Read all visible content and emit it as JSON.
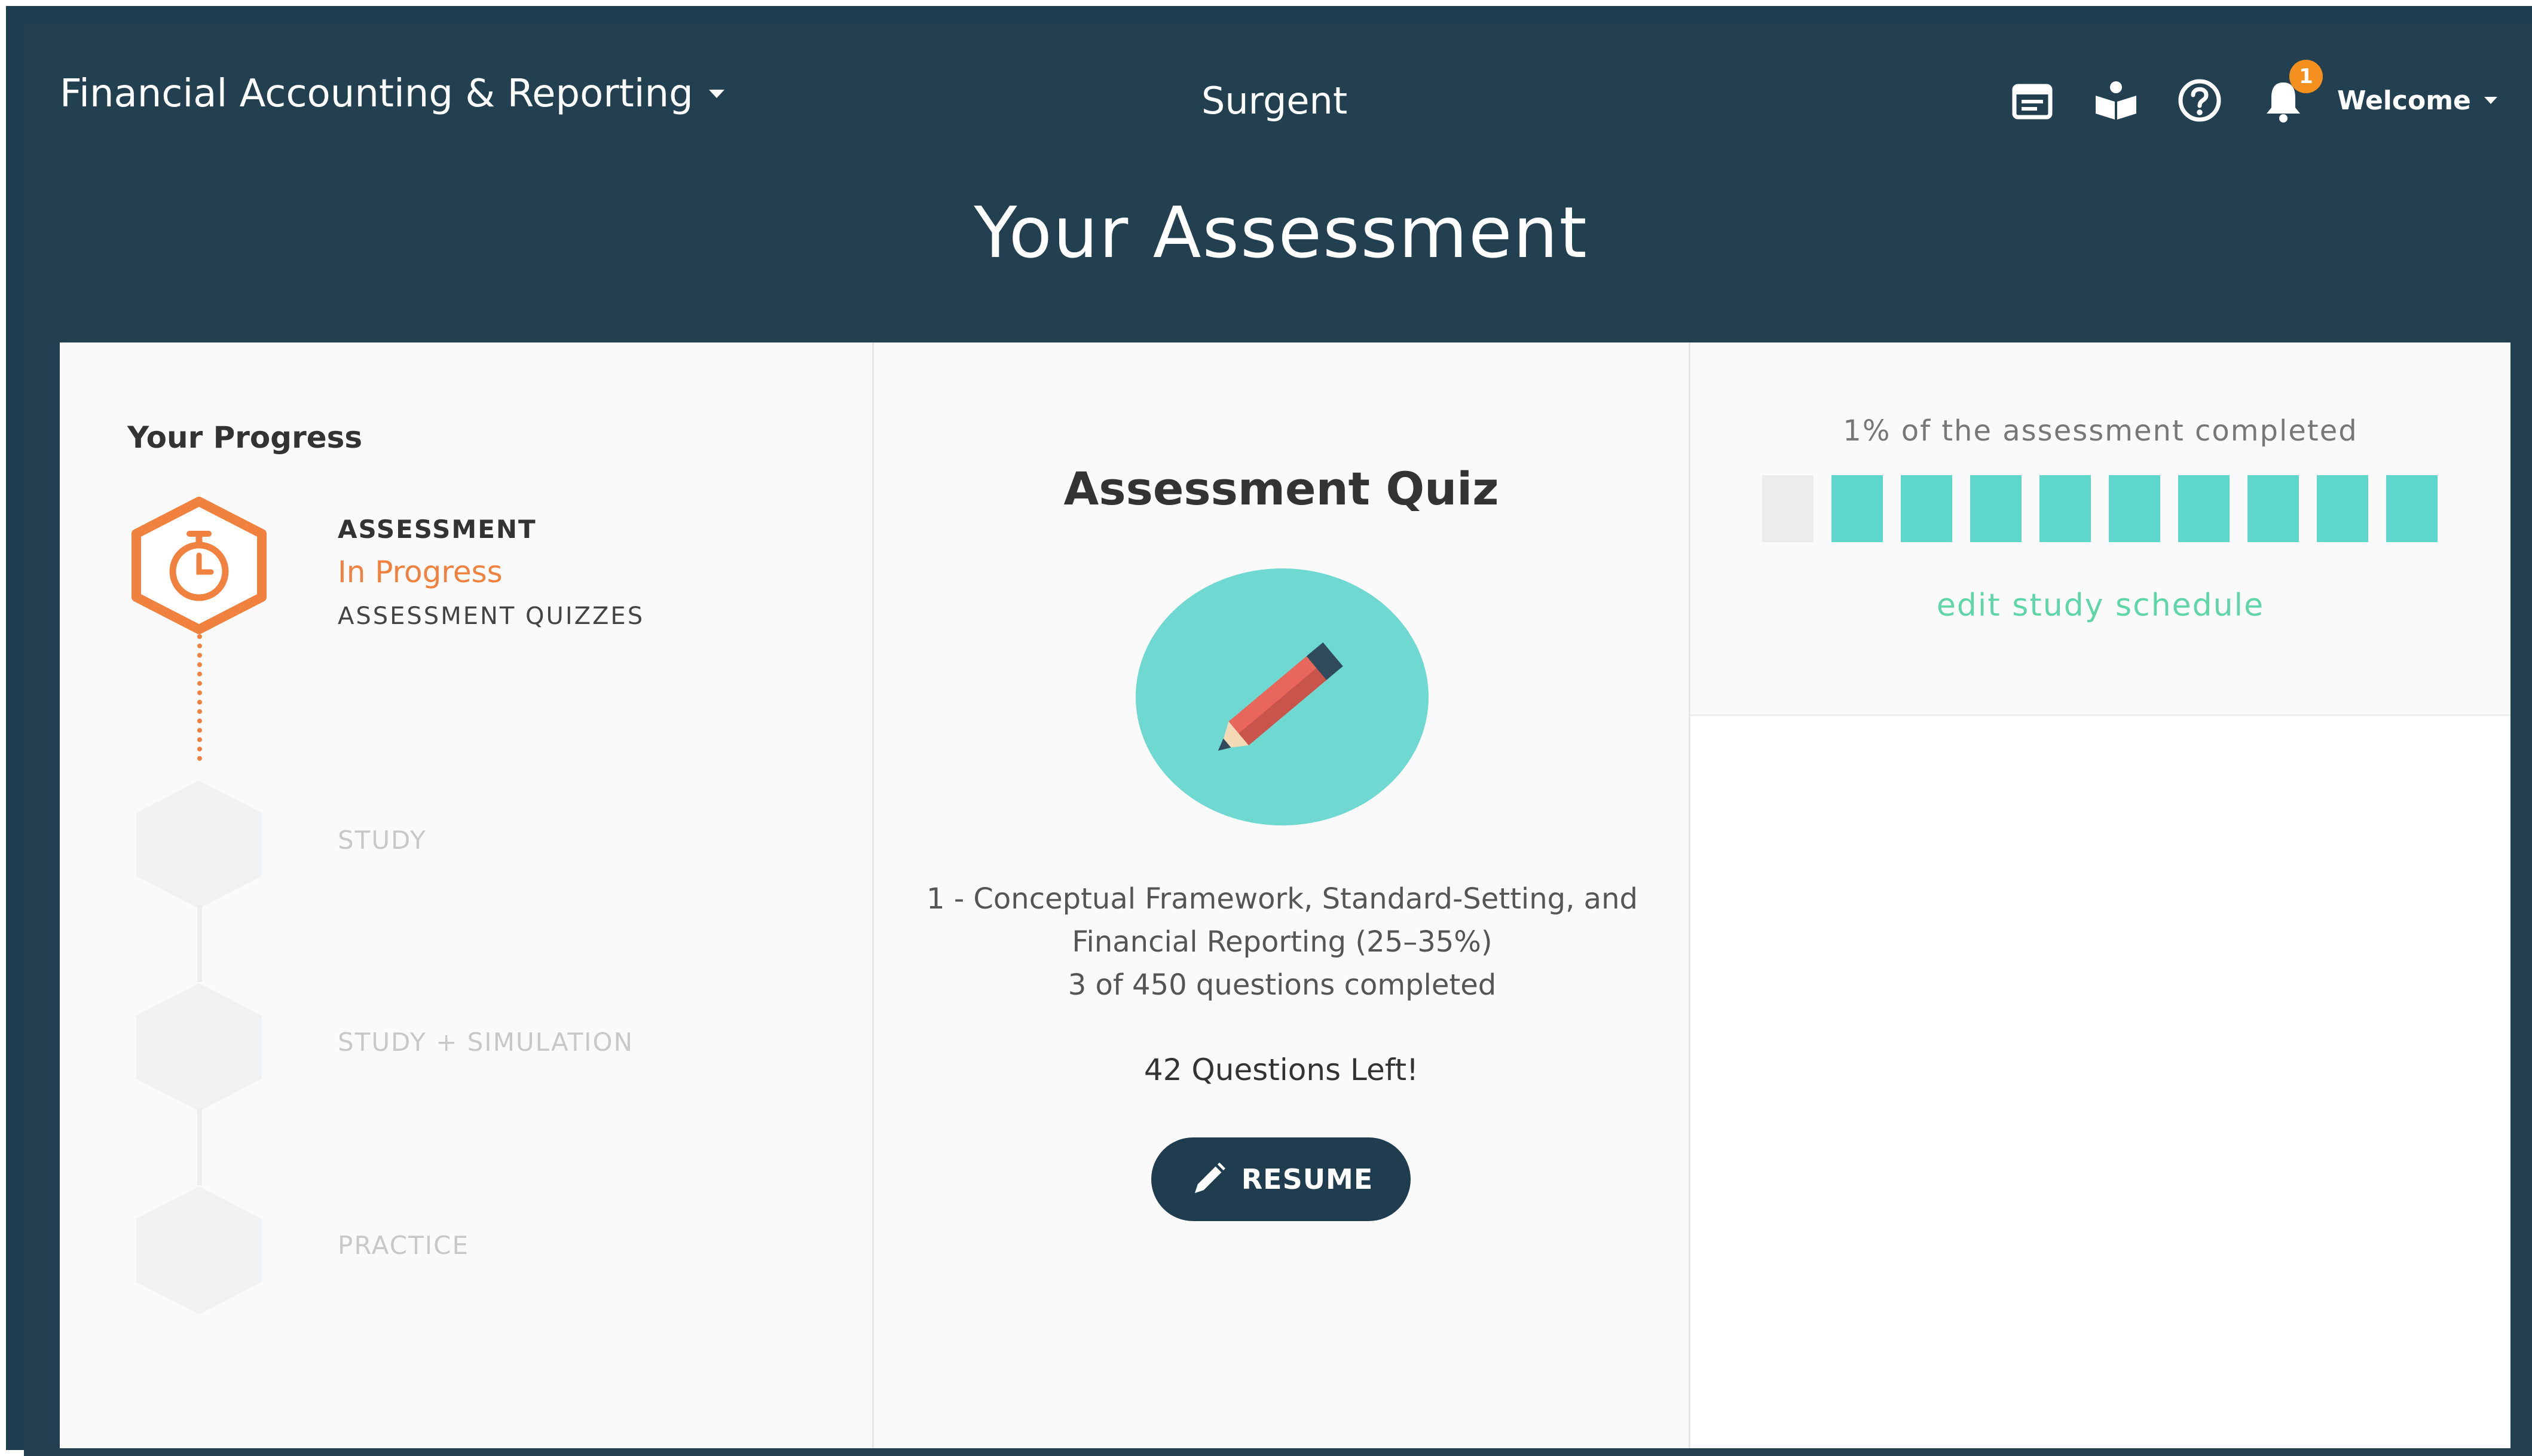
{
  "header": {
    "course_title": "Financial Accounting & Reporting",
    "brand": "Surgent",
    "notification_count": "1",
    "welcome": "Welcome",
    "icons": [
      "calendar-icon",
      "book-icon",
      "help-icon",
      "bell-icon"
    ]
  },
  "page": {
    "title": "Your Assessment"
  },
  "progress": {
    "title": "Your Progress",
    "steps": [
      {
        "label": "ASSESSMENT",
        "status": "In Progress",
        "sub": "ASSESSMENT QUIZZES",
        "state": "active"
      },
      {
        "label": "STUDY",
        "state": "inactive"
      },
      {
        "label": "STUDY + SIMULATION",
        "state": "inactive"
      },
      {
        "label": "PRACTICE",
        "state": "inactive"
      }
    ]
  },
  "quiz": {
    "title": "Assessment Quiz",
    "description": "1 - Conceptual Framework, Standard-Setting, and Financial Reporting (25–35%)",
    "completed": "3 of 450 questions completed",
    "remaining": "42 Questions Left!",
    "resume_label": "RESUME"
  },
  "completion": {
    "text": "1% of the assessment completed",
    "blocks": [
      false,
      true,
      true,
      true,
      true,
      true,
      true,
      true,
      true,
      true
    ],
    "edit_link": "edit study schedule"
  },
  "colors": {
    "header_bg": "#234050",
    "accent_orange": "#f0813e",
    "teal": "#5fd6cb",
    "link_green": "#5fd6a8",
    "button_bg": "#1f3d4f"
  }
}
